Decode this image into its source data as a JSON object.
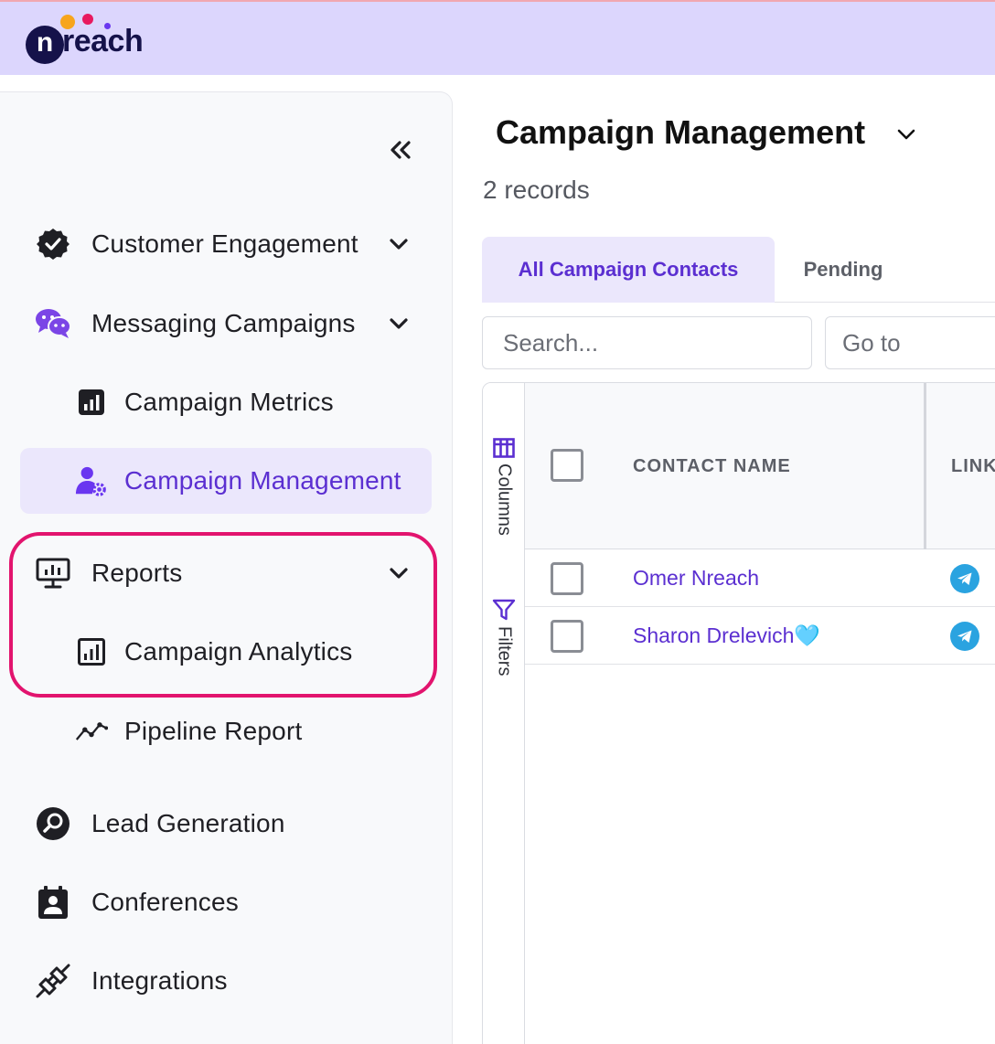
{
  "app": {
    "brand_letter": "n",
    "brand_word": "reach"
  },
  "sidebar": {
    "items": [
      {
        "label": "Customer Engagement",
        "icon": "badge-check-icon"
      },
      {
        "label": "Messaging Campaigns",
        "icon": "chat-bubbles-icon"
      },
      {
        "label": "Campaign Metrics",
        "icon": "bar-chart-square-icon"
      },
      {
        "label": "Campaign Management",
        "icon": "user-gear-icon"
      },
      {
        "label": "Reports",
        "icon": "monitor-chart-icon"
      },
      {
        "label": "Campaign Analytics",
        "icon": "bar-chart-outline-icon"
      },
      {
        "label": "Pipeline Report",
        "icon": "line-trend-icon"
      },
      {
        "label": "Lead Generation",
        "icon": "search-circle-icon"
      },
      {
        "label": "Conferences",
        "icon": "calendar-badge-icon"
      },
      {
        "label": "Integrations",
        "icon": "plug-icon"
      }
    ]
  },
  "main": {
    "title": "Campaign Management",
    "records": "2 records",
    "tabs": [
      {
        "label": "All Campaign Contacts"
      },
      {
        "label": "Pending"
      }
    ],
    "search": {
      "placeholder": "Search..."
    },
    "goto": {
      "placeholder": "Go to"
    },
    "rail": {
      "columns": "Columns",
      "filters": "Filters"
    },
    "table": {
      "headers": [
        "CONTACT NAME",
        "LINK"
      ],
      "rows": [
        {
          "name": "Omer Nreach"
        },
        {
          "name": "Sharon Drelevich🩵"
        }
      ]
    }
  },
  "colors": {
    "accent": "#5b2fd1",
    "header_bg": "#dcd6fd",
    "highlight": "#e2146e",
    "telegram": "#2aa3e0"
  }
}
